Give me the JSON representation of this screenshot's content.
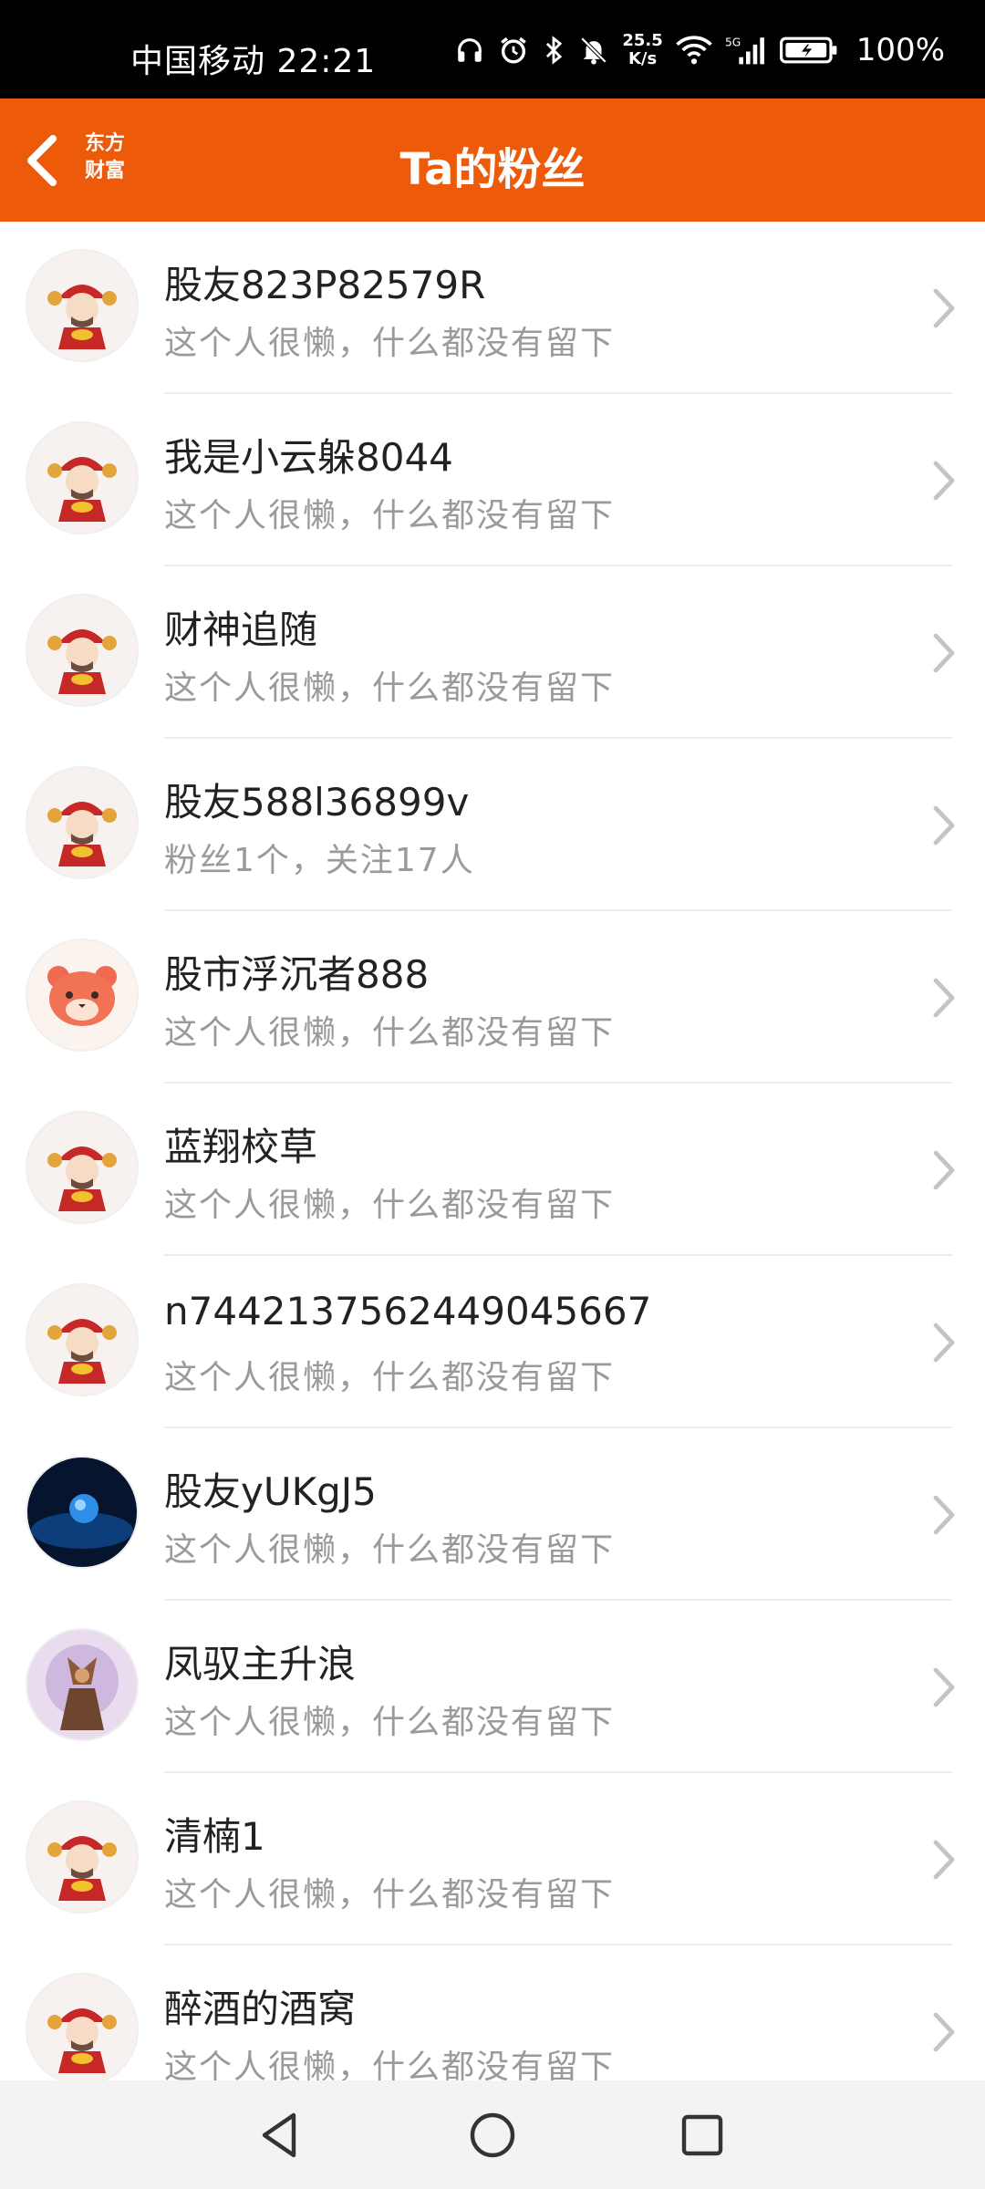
{
  "status_bar": {
    "carrier_time": "中国移动 22:21",
    "net_speed_value": "25.5",
    "net_speed_unit": "K/s",
    "battery": "100%"
  },
  "header": {
    "logo_line1": "东方",
    "logo_line2": "财富",
    "title": "Ta的粉丝"
  },
  "fans": [
    {
      "name": "股友823P82579R",
      "desc": "这个人很懒，什么都没有留下",
      "avatar": "god-of-wealth"
    },
    {
      "name": "我是小云躲8044",
      "desc": "这个人很懒，什么都没有留下",
      "avatar": "god-of-wealth"
    },
    {
      "name": "财神追随",
      "desc": "这个人很懒，什么都没有留下",
      "avatar": "god-of-wealth"
    },
    {
      "name": "股友588l36899v",
      "desc": "粉丝1个，关注17人",
      "avatar": "god-of-wealth"
    },
    {
      "name": "股市浮沉者888",
      "desc": "这个人很懒，什么都没有留下",
      "avatar": "tiger"
    },
    {
      "name": "蓝翔校草",
      "desc": "这个人很懒，什么都没有留下",
      "avatar": "god-of-wealth"
    },
    {
      "name": "n7442137562449045667",
      "desc": "这个人很懒，什么都没有留下",
      "avatar": "god-of-wealth"
    },
    {
      "name": "股友yUKgJ5",
      "desc": "这个人很懒，什么都没有留下",
      "avatar": "blue-orb"
    },
    {
      "name": "凤驭主升浪",
      "desc": "这个人很懒，什么都没有留下",
      "avatar": "warrior"
    },
    {
      "name": "清楠1",
      "desc": "这个人很懒，什么都没有留下",
      "avatar": "god-of-wealth"
    },
    {
      "name": "醉酒的酒窝",
      "desc": "这个人很懒，什么都没有留下",
      "avatar": "god-of-wealth"
    }
  ],
  "colors": {
    "header_bg": "#ec5a0a",
    "status_bg": "#000000",
    "name_text": "#222222",
    "desc_text": "#9a9a9a"
  },
  "icons": {
    "back": "chevron-left-icon",
    "row_arrow": "chevron-right-icon",
    "nav_back": "triangle-back-icon",
    "nav_home": "circle-home-icon",
    "nav_recent": "square-recents-icon"
  }
}
